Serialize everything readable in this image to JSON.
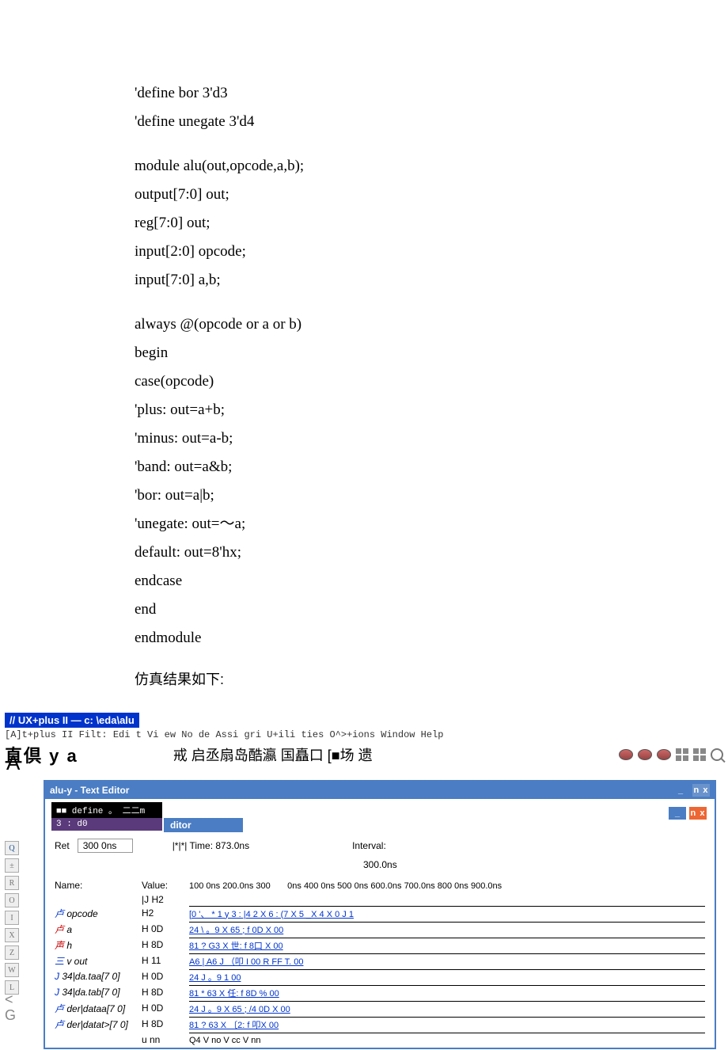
{
  "code": {
    "l1": "'define bor 3'd3",
    "l2": "'define unegate 3'd4",
    "l3": "module alu(out,opcode,a,b);",
    "l4": "output[7:0] out;",
    "l5": "reg[7:0] out;",
    "l6": "input[2:0] opcode;",
    "l7": "input[7:0] a,b;",
    "l8": "always @(opcode or a or b)",
    "l9": "begin",
    "l10": "case(opcode)",
    "l11": "'plus: out=a+b;",
    "l12": "'minus: out=a-b;",
    "l13": "'band: out=a&b;",
    "l14": "'bor: out=a|b;",
    "l15": "'unegate: out=〜a;",
    "l16": "default: out=8'hx;",
    "l17": "endcase",
    "l18": "end",
    "l19": "endmodule"
  },
  "sim_label": "仿真结果如下:",
  "app": {
    "title": "// UX+plus II — c: \\eda\\alu",
    "menu": "[A]t+plus II Filt: Edi t Vi ew No de Assi gri U+ili ties O^>+ions Window Help",
    "toolbar_left": "直倶 y a",
    "toolbar_mid": "戒 启丞扇岛酷瀛 国矗口 [■场 遗"
  },
  "window": {
    "title": "alu-y - Text Editor",
    "define_bar": "■■ define 。 二二m",
    "d0_bar": "3 : d0",
    "editor_tab": "ditor",
    "ref_label": "Ret",
    "ref_value": "300 0ns",
    "time_label": "|*|*| Time: 873.0ns",
    "interval_label": "Interval:",
    "interval_value": "300.0ns",
    "name_hdr": "Name:",
    "value_hdr": "Value:",
    "ticks_left": "100 0ns 200.0ns 300",
    "ticks_right": "0ns 400 0ns 500 0ns 600.0ns 700.0ns 800 0ns 900.0ns"
  },
  "signals": [
    {
      "name_prefix": "卢",
      "name": "opcode",
      "val": "H2",
      "wave": "[0 '、 *   1 y         3 :   |4   2 X   6 :       (7 X   5  _X 4 X      0   J 1",
      "color": "blue"
    },
    {
      "name_prefix": "卢",
      "name": "a",
      "val": "H 0D",
      "wave": "24 \\    。9 X     65 ;   f   0D X                       00",
      "color": "red"
    },
    {
      "name_prefix": "声",
      "name": "h",
      "val": "H 8D",
      "wave": "81   ?   G3 X    世:    f   8口 X                       00",
      "color": "red"
    },
    {
      "name_prefix": "三",
      "name": "v out",
      "val": "H 11",
      "wave": "A6   | A6             J （叩  I        00      R FF      T.    00",
      "color": "blue"
    },
    {
      "name_prefix": "J",
      "name": "34|da.taa[7 0]",
      "val": "H 0D",
      "wave": "24 J    。9 1                                          00",
      "color": "blue"
    },
    {
      "name_prefix": "J",
      "name": "34|da.tab[7 0]",
      "val": "H 8D",
      "wave": "81  *   63 X    任:    f  8D %                         00",
      "color": "blue"
    },
    {
      "name_prefix": "卢",
      "name": "der|dataa[7 0]",
      "val": "H 0D",
      "wave": "24 J    。9 X    65 ;   /4  0D X                        00",
      "color": "blue"
    },
    {
      "name_prefix": "卢",
      "name": "der|datat>[7 0]",
      "val": "H 8D",
      "wave": "81   ?   63 X   〔2:    f   叩X                        00",
      "color": "blue"
    },
    {
      "name_prefix": "",
      "name": "",
      "val": "u nn",
      "wave": "Q4 V no V cc                  V                         nn",
      "color": "black"
    }
  ],
  "sub_h2": "|J H2",
  "min_label": "_",
  "nx_label": "n x"
}
